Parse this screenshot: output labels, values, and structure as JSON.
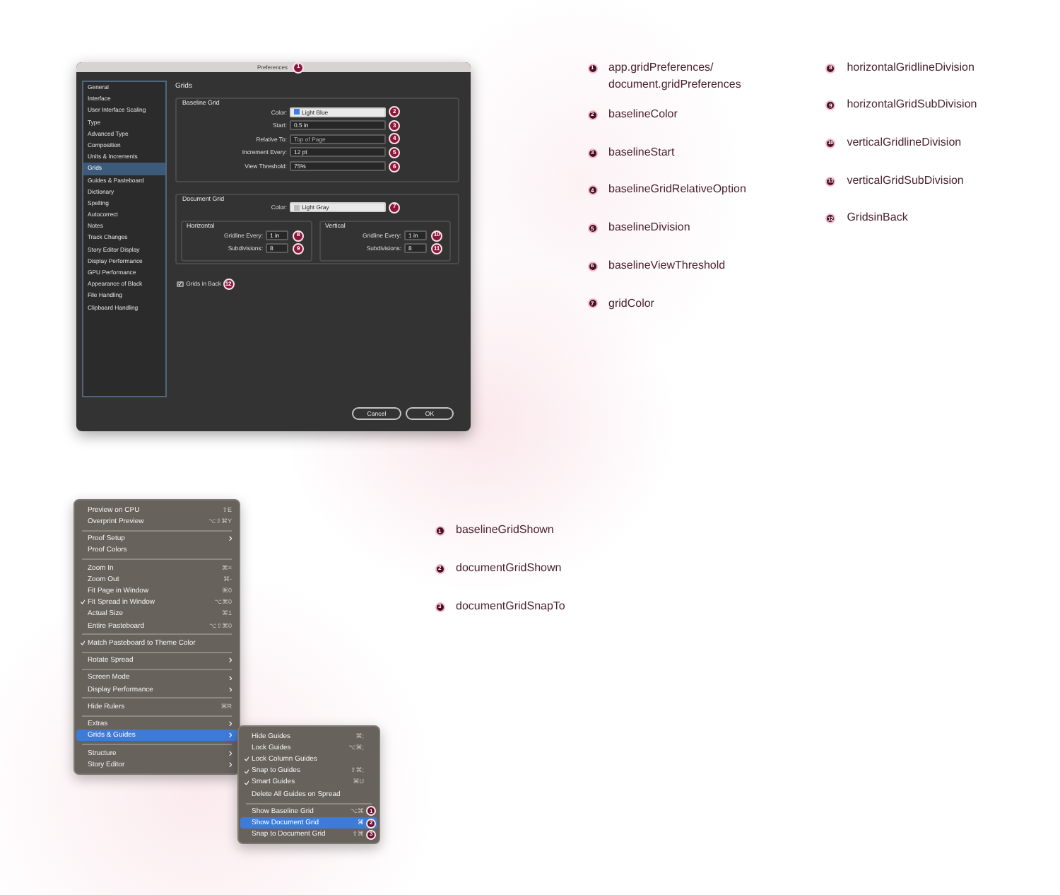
{
  "preferences_dialog": {
    "title": "Preferences",
    "title_callout": "1",
    "sidebar": {
      "items": [
        {
          "label": "General",
          "selected": false
        },
        {
          "label": "Interface",
          "selected": false
        },
        {
          "label": "User Interface Scaling",
          "selected": false
        },
        {
          "label": "Type",
          "selected": false
        },
        {
          "label": "Advanced Type",
          "selected": false
        },
        {
          "label": "Composition",
          "selected": false
        },
        {
          "label": "Units & Increments",
          "selected": false
        },
        {
          "label": "Grids",
          "selected": true
        },
        {
          "label": "Guides & Pasteboard",
          "selected": false
        },
        {
          "label": "Dictionary",
          "selected": false
        },
        {
          "label": "Spelling",
          "selected": false
        },
        {
          "label": "Autocorrect",
          "selected": false
        },
        {
          "label": "Notes",
          "selected": false
        },
        {
          "label": "Track Changes",
          "selected": false
        },
        {
          "label": "Story Editor Display",
          "selected": false
        },
        {
          "label": "Display Performance",
          "selected": false
        },
        {
          "label": "GPU Performance",
          "selected": false
        },
        {
          "label": "Appearance of Black",
          "selected": false
        },
        {
          "label": "File Handling",
          "selected": false
        },
        {
          "label": "Clipboard Handling",
          "selected": false
        }
      ]
    },
    "heading": "Grids",
    "baseline_grid": {
      "title": "Baseline Grid",
      "fields": [
        {
          "kind": "color",
          "label": "Color:",
          "value": "Light Blue",
          "color": "#3b7fe0",
          "callout": "2"
        },
        {
          "kind": "text",
          "label": "Start:",
          "value": "0.5 in",
          "callout": "3"
        },
        {
          "kind": "select",
          "label": "Relative To:",
          "value": "Top of Page",
          "callout": "4"
        },
        {
          "kind": "text",
          "label": "Increment Every:",
          "value": "12 pt",
          "callout": "5"
        },
        {
          "kind": "text",
          "label": "View Threshold:",
          "value": "75%",
          "callout": "6"
        }
      ]
    },
    "document_grid": {
      "title": "Document Grid",
      "color_field": {
        "kind": "color",
        "label": "Color:",
        "value": "Light Gray",
        "color": "#bdbdbd",
        "callout": "7"
      },
      "horizontal": {
        "title": "Horizontal",
        "fields": [
          {
            "kind": "text",
            "label": "Gridline Every:",
            "value": "1 in",
            "callout": "8"
          },
          {
            "kind": "text",
            "label": "Subdivisions:",
            "value": "8",
            "callout": "9"
          }
        ]
      },
      "vertical": {
        "title": "Vertical",
        "fields": [
          {
            "kind": "text",
            "label": "Gridline Every:",
            "value": "1 in",
            "callout": "10"
          },
          {
            "kind": "text",
            "label": "Subdivisions:",
            "value": "8",
            "callout": "11"
          }
        ]
      }
    },
    "grids_in_back": {
      "label": "Grids in Back",
      "checked": true,
      "callout": "12"
    },
    "buttons": [
      "Cancel",
      "OK"
    ]
  },
  "dialog_legend": {
    "columns": [
      {
        "items": [
          {
            "number": "1",
            "lines": [
              "app.gridPreferences/",
              "document.gridPreferences"
            ]
          },
          {
            "number": "2",
            "lines": [
              "baselineColor"
            ]
          },
          {
            "number": "3",
            "lines": [
              "baselineStart"
            ]
          },
          {
            "number": "4",
            "lines": [
              "baselineGridRelativeOption"
            ]
          },
          {
            "number": "5",
            "lines": [
              "baselineDivision"
            ]
          },
          {
            "number": "6",
            "lines": [
              "baselineViewThreshold"
            ]
          },
          {
            "number": "7",
            "lines": [
              "gridColor"
            ]
          }
        ]
      },
      {
        "items": [
          {
            "number": "8",
            "lines": [
              "horizontalGridlineDivision"
            ]
          },
          {
            "number": "9",
            "lines": [
              "horizontalGridSubDivision"
            ]
          },
          {
            "number": "10",
            "lines": [
              "verticalGridlineDivision"
            ]
          },
          {
            "number": "11",
            "lines": [
              "verticalGridSubDivision"
            ]
          },
          {
            "number": "12",
            "lines": [
              "GridsinBack"
            ]
          }
        ]
      }
    ]
  },
  "view_menu": {
    "items": [
      {
        "kind": "item",
        "label": "Preview on CPU",
        "shortcut": "⇧E",
        "checked": false,
        "selected": false,
        "submenu": false
      },
      {
        "kind": "item",
        "label": "Overprint Preview",
        "shortcut": "⌥⇧⌘Y",
        "checked": false,
        "selected": false,
        "submenu": false
      },
      {
        "kind": "separator"
      },
      {
        "kind": "item",
        "label": "Proof Setup",
        "checked": false,
        "selected": false,
        "submenu": true
      },
      {
        "kind": "item",
        "label": "Proof Colors",
        "checked": false,
        "selected": false,
        "submenu": false
      },
      {
        "kind": "separator"
      },
      {
        "kind": "item",
        "label": "Zoom In",
        "shortcut": "⌘=",
        "checked": false,
        "selected": false,
        "submenu": false
      },
      {
        "kind": "item",
        "label": "Zoom Out",
        "shortcut": "⌘-",
        "checked": false,
        "selected": false,
        "submenu": false
      },
      {
        "kind": "item",
        "label": "Fit Page in Window",
        "shortcut": "⌘0",
        "checked": false,
        "selected": false,
        "submenu": false
      },
      {
        "kind": "item",
        "label": "Fit Spread in Window",
        "shortcut": "⌥⌘0",
        "checked": true,
        "selected": false,
        "submenu": false
      },
      {
        "kind": "item",
        "label": "Actual Size",
        "shortcut": "⌘1",
        "checked": false,
        "selected": false,
        "submenu": false
      },
      {
        "kind": "item",
        "label": "Entire Pasteboard",
        "shortcut": "⌥⇧⌘0",
        "checked": false,
        "selected": false,
        "submenu": false
      },
      {
        "kind": "separator"
      },
      {
        "kind": "item",
        "label": "Match Pasteboard to Theme Color",
        "checked": true,
        "selected": false,
        "submenu": false
      },
      {
        "kind": "separator"
      },
      {
        "kind": "item",
        "label": "Rotate Spread",
        "checked": false,
        "selected": false,
        "submenu": true
      },
      {
        "kind": "separator"
      },
      {
        "kind": "item",
        "label": "Screen Mode",
        "checked": false,
        "selected": false,
        "submenu": true
      },
      {
        "kind": "item",
        "label": "Display Performance",
        "checked": false,
        "selected": false,
        "submenu": true
      },
      {
        "kind": "separator"
      },
      {
        "kind": "item",
        "label": "Hide Rulers",
        "shortcut": "⌘R",
        "checked": false,
        "selected": false,
        "submenu": false
      },
      {
        "kind": "separator"
      },
      {
        "kind": "item",
        "label": "Extras",
        "checked": false,
        "selected": false,
        "submenu": true
      },
      {
        "kind": "item",
        "label": "Grids & Guides",
        "checked": false,
        "selected": true,
        "submenu": true
      },
      {
        "kind": "separator"
      },
      {
        "kind": "item",
        "label": "Structure",
        "checked": false,
        "selected": false,
        "submenu": true
      },
      {
        "kind": "item",
        "label": "Story Editor",
        "checked": false,
        "selected": false,
        "submenu": true
      }
    ]
  },
  "grids_guides_submenu": {
    "items": [
      {
        "kind": "item",
        "label": "Hide Guides",
        "shortcut": "⌘;",
        "checked": false,
        "selected": false,
        "submenu": false
      },
      {
        "kind": "item",
        "label": "Lock Guides",
        "shortcut": "⌥⌘;",
        "checked": false,
        "selected": false,
        "submenu": false
      },
      {
        "kind": "item",
        "label": "Lock Column Guides",
        "checked": true,
        "selected": false,
        "submenu": false
      },
      {
        "kind": "item",
        "label": "Snap to Guides",
        "shortcut": "⇧⌘;",
        "checked": true,
        "selected": false,
        "submenu": false
      },
      {
        "kind": "item",
        "label": "Smart Guides",
        "shortcut": "⌘U",
        "checked": true,
        "selected": false,
        "submenu": false
      },
      {
        "kind": "item",
        "label": "Delete All Guides on Spread",
        "checked": false,
        "selected": false,
        "submenu": false
      },
      {
        "kind": "separator"
      },
      {
        "kind": "item",
        "label": "Show Baseline Grid",
        "shortcut": "⌥⌘",
        "checked": false,
        "selected": false,
        "submenu": false,
        "callout": "1"
      },
      {
        "kind": "item",
        "label": "Show Document Grid",
        "shortcut": "⌘",
        "checked": false,
        "selected": true,
        "submenu": false,
        "callout": "2"
      },
      {
        "kind": "item",
        "label": "Snap to Document Grid",
        "shortcut": "⇧⌘",
        "checked": false,
        "selected": false,
        "submenu": false,
        "callout": "3"
      }
    ]
  },
  "menu_legend": {
    "columns": [
      {
        "items": [
          {
            "number": "1",
            "lines": [
              "baselineGridShown"
            ]
          },
          {
            "number": "2",
            "lines": [
              "documentGridShown"
            ]
          },
          {
            "number": "3",
            "lines": [
              "documentGridSnapTo"
            ]
          }
        ]
      }
    ]
  }
}
